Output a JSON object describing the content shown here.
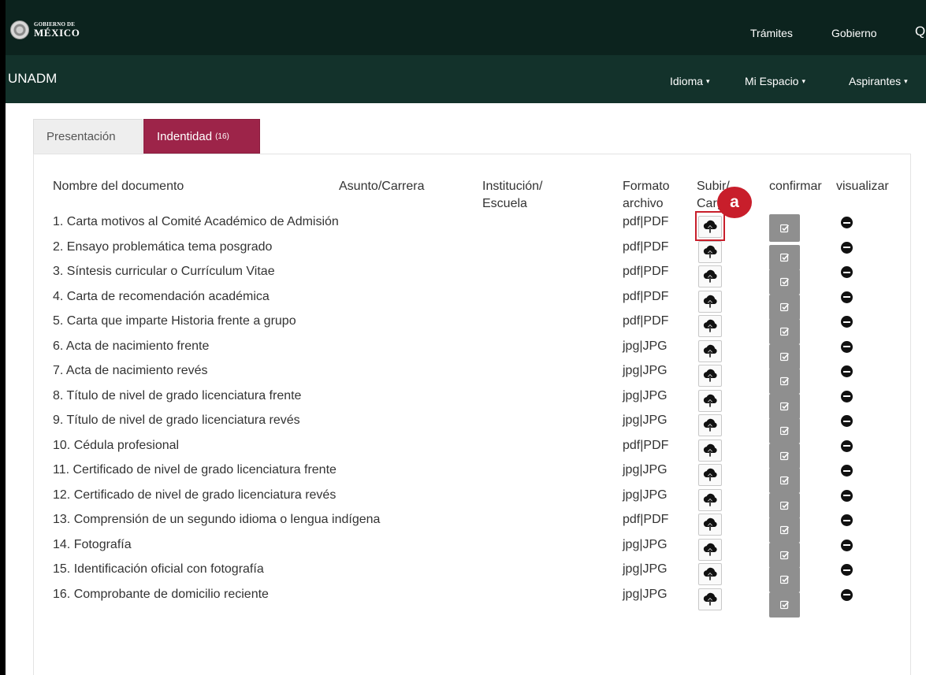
{
  "gob_header": {
    "logo_small": "GOBIERNO DE",
    "logo_big": "MÉXICO",
    "links": [
      "Trámites",
      "Gobierno"
    ],
    "search_glyph": "Q"
  },
  "navbar": {
    "brand": "UNADM",
    "menus": [
      "Idioma",
      "Mi Espacio",
      "Aspirantes"
    ],
    "caret": "▾"
  },
  "tabs": {
    "presentacion": "Presentación",
    "identidad": "Indentidad",
    "identidad_count": "(16)"
  },
  "table": {
    "headers": {
      "nombre": "Nombre del documento",
      "asunto": "Asunto/Carrera",
      "institucion": "Institución/\nEscuela",
      "formato": "Formato\narchivo",
      "subir": "Subir/\nCargar",
      "confirmar": "confirmar",
      "visualizar": "visualizar"
    },
    "rows": [
      {
        "name": "1. Carta motivos al Comité Académico de Admisión",
        "format": "pdf|PDF"
      },
      {
        "name": "2. Ensayo problemática tema posgrado",
        "format": "pdf|PDF"
      },
      {
        "name": "3. Síntesis curricular o Currículum Vitae",
        "format": "pdf|PDF"
      },
      {
        "name": "4. Carta de recomendación académica",
        "format": "pdf|PDF"
      },
      {
        "name": "5. Carta que imparte Historia frente a grupo",
        "format": "pdf|PDF"
      },
      {
        "name": "6. Acta de nacimiento frente",
        "format": "jpg|JPG"
      },
      {
        "name": "7. Acta de nacimiento revés",
        "format": "jpg|JPG"
      },
      {
        "name": "8. Título de nivel de grado licenciatura frente",
        "format": "jpg|JPG"
      },
      {
        "name": "9. Título de nivel de grado licenciatura revés",
        "format": "jpg|JPG"
      },
      {
        "name": "10. Cédula profesional",
        "format": "pdf|PDF"
      },
      {
        "name": "11. Certificado de nivel de grado licenciatura frente",
        "format": "jpg|JPG"
      },
      {
        "name": "12. Certificado de nivel de grado licenciatura revés",
        "format": "jpg|JPG"
      },
      {
        "name": "13. Comprensión de un segundo idioma o lengua indígena",
        "format": "pdf|PDF"
      },
      {
        "name": "14. Fotografía",
        "format": "jpg|JPG"
      },
      {
        "name": "15. Identificación oficial con fotografía",
        "format": "jpg|JPG"
      },
      {
        "name": "16. Comprobante de domicilio reciente",
        "format": "jpg|JPG"
      }
    ],
    "icons": {
      "upload": "cloud-upload-icon",
      "confirm": "edit-check-icon",
      "view": "minus-circle-icon"
    }
  },
  "annotation": {
    "label": "a",
    "color": "#c81e2b"
  },
  "colors": {
    "gob_bar": "#0c231e",
    "nav_bar": "#13322b",
    "active_tab": "#9d2449",
    "confirm_button": "#8f8f8f"
  }
}
